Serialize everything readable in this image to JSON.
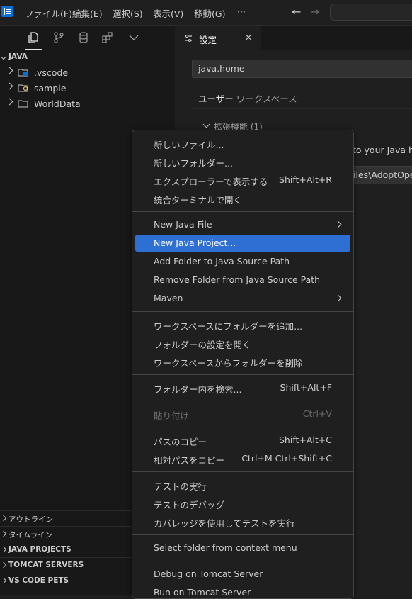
{
  "titlebar": {
    "menus": [
      "ファイル(F)",
      "編集(E)",
      "選択(S)",
      "表示(V)",
      "移動(G)",
      "···"
    ],
    "back_glyph": "←",
    "forward_glyph": "→"
  },
  "sidebar": {
    "activity_icons": [
      "files-icon",
      "source-control-icon",
      "database-icon",
      "extensions-icon",
      "chevron-down-icon"
    ],
    "root_label": "JAVA",
    "tree": [
      {
        "label": ".vscode",
        "icon": "vscode-folder-icon"
      },
      {
        "label": "sample",
        "icon": "bulb-folder-icon"
      },
      {
        "label": "WorldData",
        "icon": "folder-icon"
      }
    ],
    "sections": [
      "アウトライン",
      "タイムライン",
      "JAVA PROJECTS",
      "TOMCAT SERVERS",
      "VS CODE PETS"
    ]
  },
  "editor": {
    "tab_label": "設定",
    "close_glyph": "✕",
    "search_value": "java.home",
    "scope_tabs": [
      "ユーザー",
      "ワークスペース"
    ],
    "group_label": "拡張機能 (1)",
    "snippet_1": "to your Java ho",
    "snippet_2": "iles\\AdoptOpen"
  },
  "context_menu": {
    "groups": [
      [
        {
          "label": "新しいファイル...",
          "shortcut": ""
        },
        {
          "label": "新しいフォルダー...",
          "shortcut": ""
        },
        {
          "label": "エクスプローラーで表示する",
          "shortcut": "Shift+Alt+R"
        },
        {
          "label": "統合ターミナルで開く",
          "shortcut": ""
        }
      ],
      [
        {
          "label": "New Java File",
          "shortcut": "",
          "submenu": true
        },
        {
          "label": "New Java Project...",
          "shortcut": "",
          "active": true
        },
        {
          "label": "Add Folder to Java Source Path",
          "shortcut": ""
        },
        {
          "label": "Remove Folder from Java Source Path",
          "shortcut": ""
        },
        {
          "label": "Maven",
          "shortcut": "",
          "submenu": true
        }
      ],
      [
        {
          "label": "ワークスペースにフォルダーを追加...",
          "shortcut": ""
        },
        {
          "label": "フォルダーの設定を開く",
          "shortcut": ""
        },
        {
          "label": "ワークスペースからフォルダーを削除",
          "shortcut": ""
        }
      ],
      [
        {
          "label": "フォルダー内を検索...",
          "shortcut": "Shift+Alt+F"
        }
      ],
      [
        {
          "label": "貼り付け",
          "shortcut": "Ctrl+V",
          "disabled": true
        }
      ],
      [
        {
          "label": "パスのコピー",
          "shortcut": "Shift+Alt+C"
        },
        {
          "label": "相対パスをコピー",
          "shortcut": "Ctrl+M Ctrl+Shift+C"
        }
      ],
      [
        {
          "label": "テストの実行",
          "shortcut": ""
        },
        {
          "label": "テストのデバッグ",
          "shortcut": ""
        },
        {
          "label": "カバレッジを使用してテストを実行",
          "shortcut": ""
        }
      ],
      [
        {
          "label": "Select folder from context menu",
          "shortcut": ""
        }
      ],
      [
        {
          "label": "Debug on Tomcat Server",
          "shortcut": ""
        },
        {
          "label": "Run on Tomcat Server",
          "shortcut": ""
        }
      ]
    ]
  },
  "colors": {
    "accent": "#0078d4",
    "highlight": "#2d6fd2",
    "background": "#1f1f1f",
    "sidebar": "#181818"
  }
}
